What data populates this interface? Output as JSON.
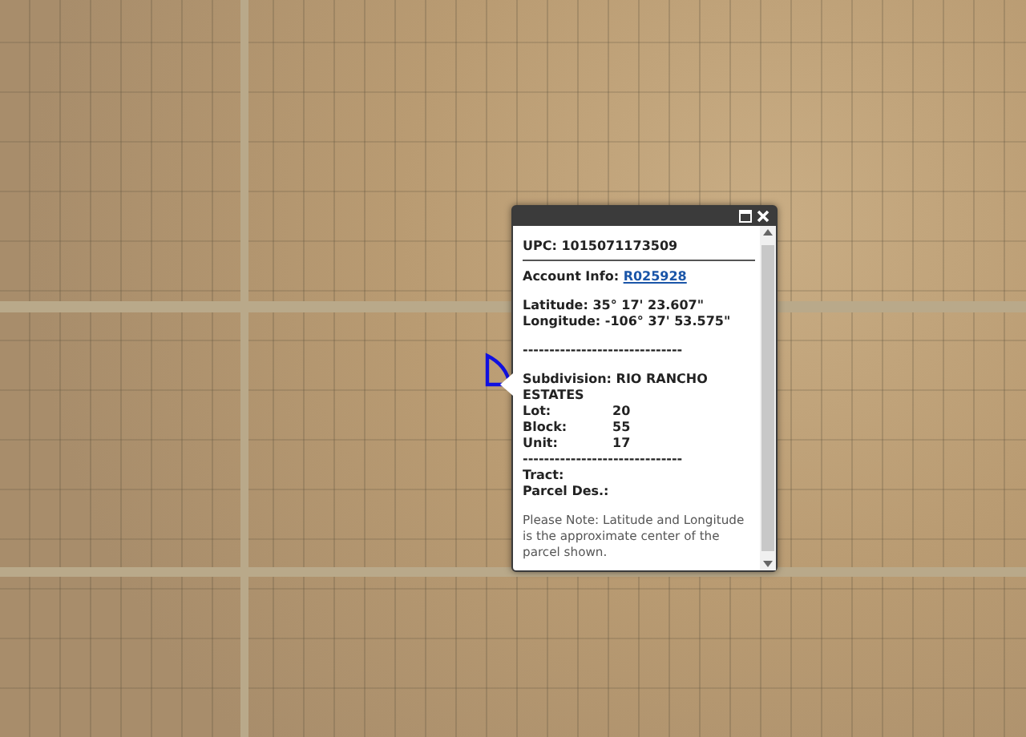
{
  "map": {
    "parcel_selected": true
  },
  "popup": {
    "fields": [
      {
        "kind": "pair",
        "label": "UPC:",
        "value": "1015071173509"
      },
      {
        "kind": "rule"
      },
      {
        "kind": "link",
        "label": "Account Info:",
        "value": "R025928"
      },
      {
        "kind": "gap"
      },
      {
        "kind": "pair",
        "label": "Latitude:",
        "value": "35° 17' 23.607\""
      },
      {
        "kind": "pair",
        "label": "Longitude:",
        "value": "-106° 37' 53.575\""
      },
      {
        "kind": "gap"
      },
      {
        "kind": "text",
        "value": "------------------------------"
      },
      {
        "kind": "gap"
      },
      {
        "kind": "pair",
        "label": "Subdivision:",
        "value": "RIO RANCHO ESTATES"
      },
      {
        "kind": "column",
        "label": "Lot:",
        "value": "20"
      },
      {
        "kind": "column",
        "label": "Block:",
        "value": "55"
      },
      {
        "kind": "column",
        "label": "Unit:",
        "value": "17"
      },
      {
        "kind": "text",
        "value": "------------------------------"
      },
      {
        "kind": "pair",
        "label": "Tract:"
      },
      {
        "kind": "pair",
        "label": "Parcel Des.:"
      },
      {
        "kind": "gap"
      },
      {
        "kind": "note",
        "value": "Please Note: Latitude and Longitude is the approximate center of the parcel shown."
      }
    ]
  }
}
